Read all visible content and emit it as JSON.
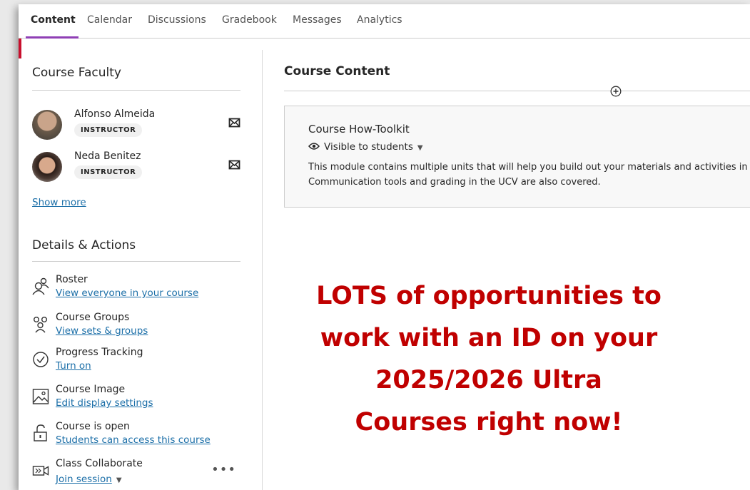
{
  "nav": {
    "tabs": [
      {
        "label": "Content",
        "active": true
      },
      {
        "label": "Calendar"
      },
      {
        "label": "Discussions"
      },
      {
        "label": "Gradebook"
      },
      {
        "label": "Messages"
      },
      {
        "label": "Analytics"
      }
    ]
  },
  "faculty": {
    "title": "Course Faculty",
    "members": [
      {
        "name": "Alfonso Almeida",
        "role": "INSTRUCTOR"
      },
      {
        "name": "Neda Benitez",
        "role": "INSTRUCTOR"
      }
    ],
    "show_more": "Show more"
  },
  "details": {
    "title": "Details & Actions",
    "items": [
      {
        "title": "Roster",
        "link": "View everyone in your course",
        "icon": "roster-icon"
      },
      {
        "title": "Course Groups",
        "link": "View sets & groups",
        "icon": "groups-icon"
      },
      {
        "title": "Progress Tracking",
        "link": "Turn on",
        "icon": "checkmark-circle-icon"
      },
      {
        "title": "Course Image",
        "link": "Edit display settings",
        "icon": "image-icon"
      },
      {
        "title": "Course is open",
        "link": "Students can access this course",
        "icon": "unlock-icon"
      },
      {
        "title": "Class Collaborate",
        "link": "Join session",
        "icon": "video-icon",
        "has_menu": true
      }
    ]
  },
  "content": {
    "title": "Course Content",
    "module": {
      "title": "Course How-Toolkit",
      "visibility": "Visible to students",
      "description": "This module contains multiple units that will help you build out your materials and activities in Communication tools and grading in the UCV are also covered."
    }
  },
  "overlay": {
    "lines": [
      "LOTS of opportunities to",
      "work with an ID on your",
      "2025/2026 Ultra",
      "Courses right now!"
    ]
  },
  "colors": {
    "accent_underline": "#8f3fb5",
    "link": "#1c6fa8",
    "overlay_text": "#c00000",
    "red_marker": "#c8102e"
  }
}
